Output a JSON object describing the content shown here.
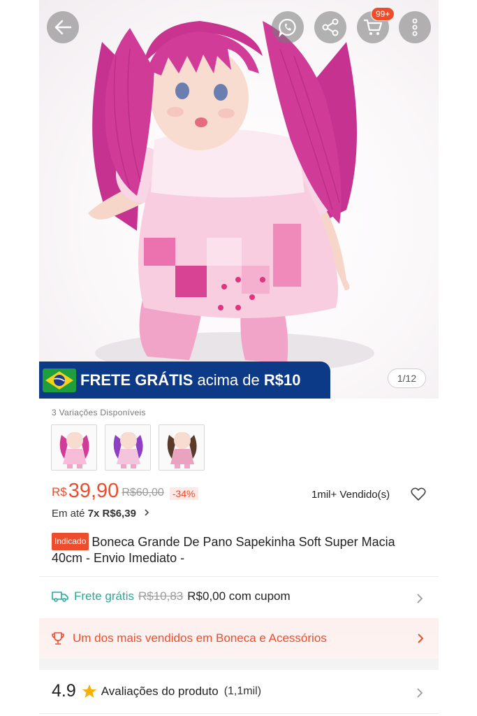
{
  "header": {
    "cart_badge": "99+"
  },
  "hero": {
    "frete_banner": {
      "bold": "FRETE GRÁTIS",
      "rest": " acima de ",
      "amount": "R$10"
    },
    "image_counter": "1/12"
  },
  "variations": {
    "title": "3 Variações Disponíveis",
    "options": [
      "pink",
      "purple",
      "brown"
    ]
  },
  "price": {
    "currency": "R$",
    "current": "39,90",
    "original": "R$60,00",
    "discount": "-34%",
    "sold": "1mil+ Vendido(s)",
    "installments_prefix": "Em até ",
    "installments_bold": "7x R$6,39"
  },
  "product": {
    "tag": "Indicado",
    "title": "Boneca Grande De Pano Sapekinha Soft Super Macia 40cm - Envio Imediato -"
  },
  "shipping": {
    "label": "Frete grátis",
    "old_price": "R$10,83",
    "new_price": "R$0,00 com cupom"
  },
  "bestseller": {
    "text": "Um dos mais vendidos em Boneca e Acessórios"
  },
  "reviews": {
    "rating": "4.9",
    "label": "Avaliações do produto",
    "count": "(1,1mil)"
  },
  "colors": {
    "accent": "#ee4d2d",
    "teal": "#26aa99",
    "banner_blue": "#0d3a86"
  }
}
